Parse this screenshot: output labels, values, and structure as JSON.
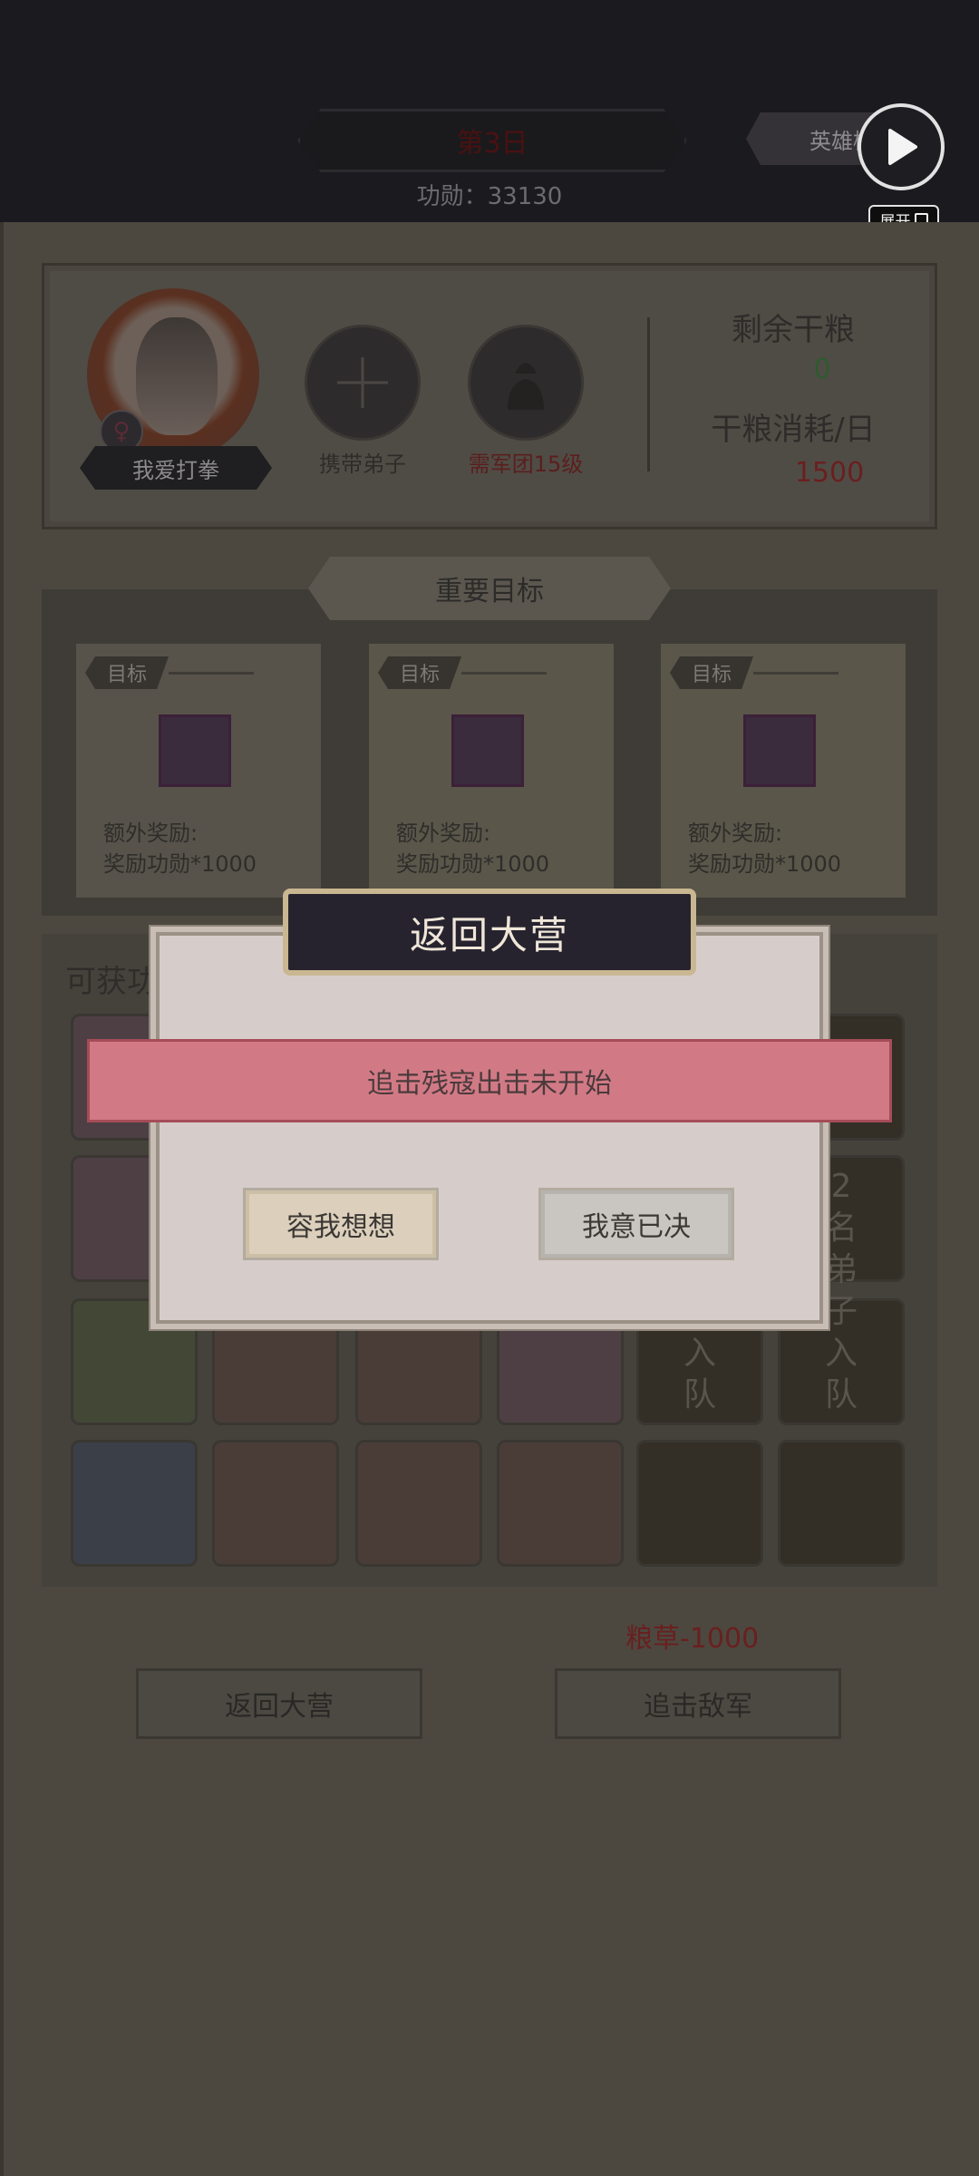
{
  "header": {
    "day": "第3日",
    "merit": "功勋：33130",
    "rank_button": "英雄榜",
    "expand_label": "展开"
  },
  "character": {
    "name": "我爱打拳",
    "gender_symbol": "♀",
    "slot1_label": "携带弟子",
    "slot2_label": "需军团15级",
    "food_left_label": "剩余干粮",
    "food_left_value": "0",
    "food_cost_label": "干粮消耗/日",
    "food_cost_value": "1500"
  },
  "goals": {
    "title": "重要目标",
    "items": [
      {
        "tag": "目标",
        "line1": "额外奖励:",
        "line2": "奖励功勋*1000"
      },
      {
        "tag": "目标",
        "line1": "额外奖励:",
        "line2": "奖励功勋*1000"
      },
      {
        "tag": "目标",
        "line1": "额外奖励:",
        "line2": "奖励功勋*1000"
      }
    ]
  },
  "rewards": {
    "title": "可获功",
    "recruit_col5": "入\n队",
    "recruit_col6": "2\n名\n弟\n子\n入\n队"
  },
  "footer": {
    "grain_cost": "粮草-1000",
    "return_button": "返回大营",
    "chase_button": "追击敌军"
  },
  "modal": {
    "title": "返回大营",
    "alert": "追击残寇出击未开始",
    "think_button": "容我想想",
    "decide_button": "我意已决"
  },
  "colors": {
    "modal_alert": "#d17a85",
    "food_left_value": "#2f5a2f",
    "food_cost_value": "#6a1f1f"
  }
}
